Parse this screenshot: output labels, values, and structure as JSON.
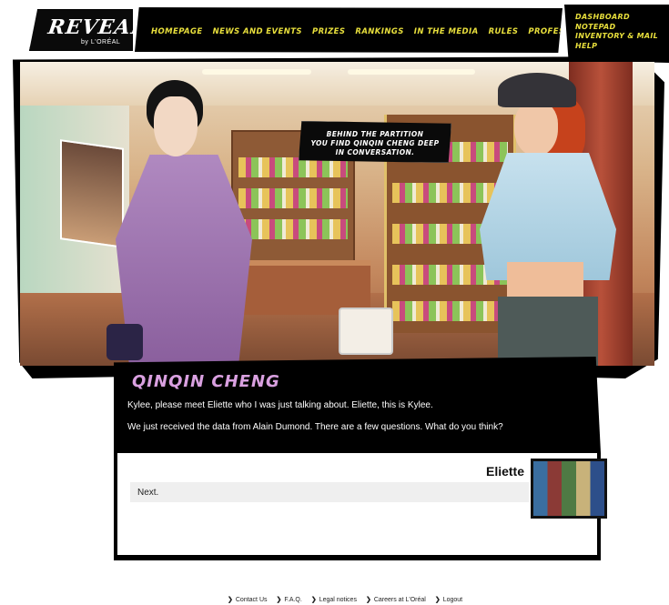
{
  "logo": {
    "brand": "REVEAL",
    "by": "by L'ORÉAL"
  },
  "main_nav": [
    "HOMEPAGE",
    "NEWS AND EVENTS",
    "PRIZES",
    "RANKINGS",
    "IN THE MEDIA",
    "RULES",
    "PROFESSORS"
  ],
  "right_nav": [
    "DASHBOARD",
    "NOTEPAD",
    "INVENTORY & MAIL",
    "HELP"
  ],
  "scene": {
    "caption": [
      "BEHIND THE PARTITION",
      "YOU FIND QINQIN CHENG DEEP",
      "IN CONVERSATION."
    ]
  },
  "dialog": {
    "speaker": "QINQIN CHENG",
    "lines": [
      "Kylee, please meet Eliette who I was just talking about. Eliette, this is Kylee.",
      "We just received the data from Alain Dumond. There are a few questions. What do you think?"
    ]
  },
  "reply": {
    "name": "Eliette",
    "option": "Next."
  },
  "footer": [
    "Contact Us",
    "F.A.Q.",
    "Legal notices",
    "Careers at L'Oréal",
    "Logout"
  ],
  "colors": {
    "nav_yellow": "#e8df3c",
    "speaker_pink": "#d9a0e0"
  }
}
